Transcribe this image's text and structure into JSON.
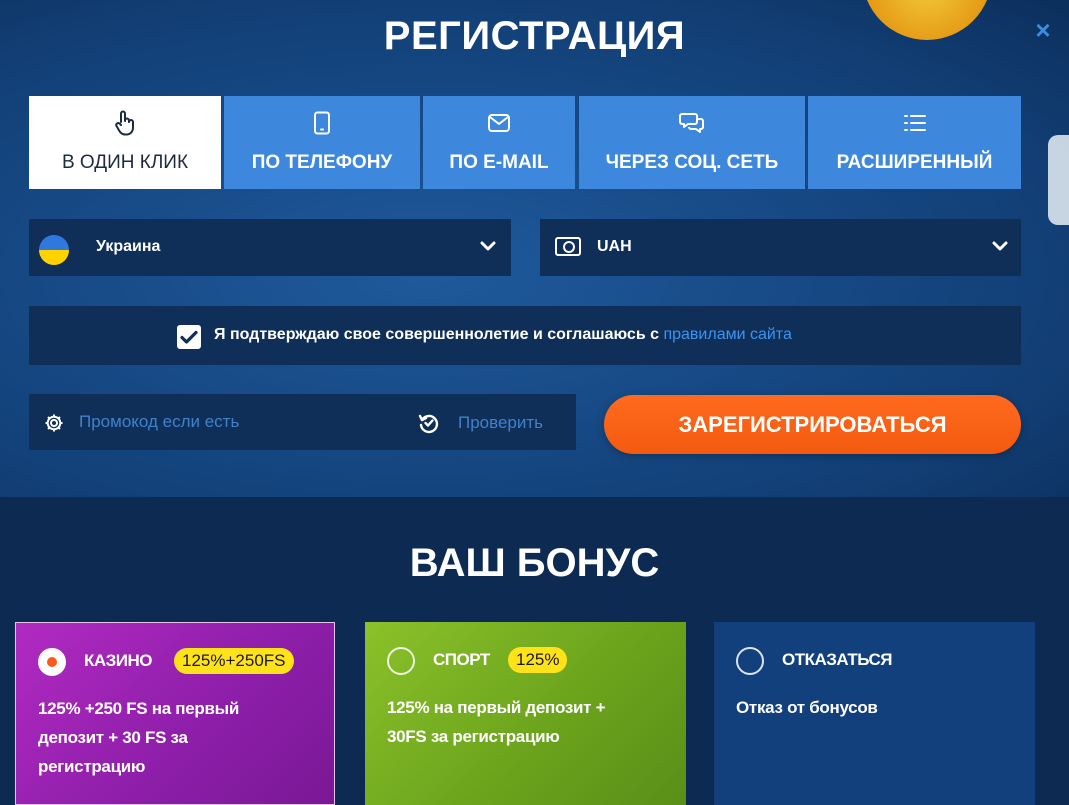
{
  "header": {
    "title": "РЕГИСТРАЦИЯ",
    "close_icon": "×"
  },
  "tabs": [
    {
      "label": "В ОДИН КЛИК",
      "icon": "hand-pointer-icon",
      "active": true
    },
    {
      "label": "ПО ТЕЛЕФОНУ",
      "icon": "phone-icon",
      "active": false
    },
    {
      "label": "ПО E-MAIL",
      "icon": "envelope-icon",
      "active": false
    },
    {
      "label": "ЧЕРЕЗ СОЦ. СЕТЬ",
      "icon": "chat-bubbles-icon",
      "active": false
    },
    {
      "label": "РАСШИРЕННЫЙ",
      "icon": "list-icon",
      "active": false
    }
  ],
  "form": {
    "country": "Украина",
    "currency": "UAH",
    "agree_text": "Я подтверждаю свое совершеннолетие и соглашаюсь с ",
    "agree_link": "правилами сайта",
    "agree_checked": true,
    "promo_placeholder": "Промокод если есть",
    "promo_value": "",
    "check_label": "Проверить",
    "register_label": "ЗАРЕГИСТРИРОВАТЬСЯ"
  },
  "bonus": {
    "title": "ВАШ БОНУС",
    "options": [
      {
        "name": "КАЗИНО",
        "badge": "125%+250FS",
        "desc_lines": [
          "125% +250 FS на первый",
          "депозит + 30 FS за",
          "регистрацию"
        ],
        "selected": true
      },
      {
        "name": "СПОРТ",
        "badge": "125%",
        "desc_lines": [
          "125% на первый депозит +",
          "30FS за регистрацию"
        ],
        "selected": false
      },
      {
        "name": "ОТКАЗАТЬСЯ",
        "badge": "",
        "desc_lines": [
          "Отказ от бонусов"
        ],
        "selected": false
      }
    ]
  },
  "colors": {
    "tab_active_bg": "#ffffff",
    "tab_bg": "#3d87dc",
    "register_button": "#ff6a1e",
    "link": "#3a95f0",
    "badge": "#ffe21a"
  }
}
